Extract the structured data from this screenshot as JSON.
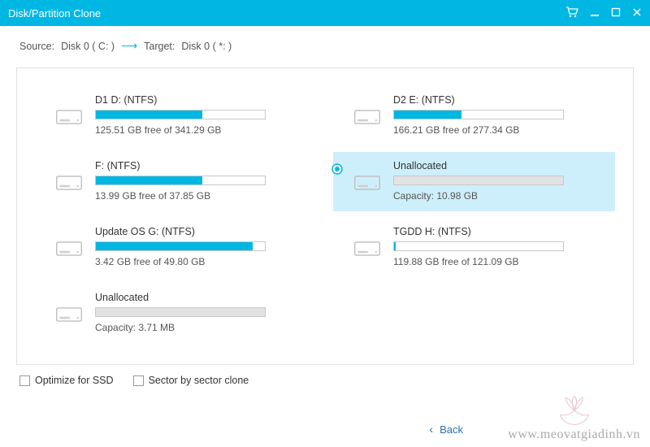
{
  "window": {
    "title": "Disk/Partition Clone"
  },
  "source_target": {
    "source_label": "Source:",
    "source_value": "Disk 0 ( C: )",
    "target_label": "Target:",
    "target_value": "Disk 0 ( *: )"
  },
  "partitions": [
    {
      "name": "D1 D: (NTFS)",
      "sub": "125.51 GB free of 341.29 GB",
      "used_pct": 63,
      "type": "normal",
      "selected": false
    },
    {
      "name": "D2 E: (NTFS)",
      "sub": "166.21 GB free of 277.34 GB",
      "used_pct": 40,
      "type": "normal",
      "selected": false
    },
    {
      "name": "F: (NTFS)",
      "sub": "13.99 GB free of 37.85 GB",
      "used_pct": 63,
      "type": "normal",
      "selected": false
    },
    {
      "name": "Unallocated",
      "sub": "Capacity: 10.98 GB",
      "used_pct": 0,
      "type": "unallocated",
      "selected": true
    },
    {
      "name": "Update OS G: (NTFS)",
      "sub": "3.42 GB free of 49.80 GB",
      "used_pct": 93,
      "type": "normal",
      "selected": false
    },
    {
      "name": "TGDD H: (NTFS)",
      "sub": "119.88 GB free of 121.09 GB",
      "used_pct": 1,
      "type": "normal",
      "selected": false
    },
    {
      "name": "Unallocated",
      "sub": "Capacity: 3.71 MB",
      "used_pct": 0,
      "type": "unallocated",
      "selected": false
    }
  ],
  "options": {
    "ssd_label": "Optimize for SSD",
    "ssd_checked": false,
    "sector_label": "Sector by sector clone",
    "sector_checked": false
  },
  "footer": {
    "back_label": "Back"
  },
  "watermark": "www.meovatgiadinh.vn"
}
